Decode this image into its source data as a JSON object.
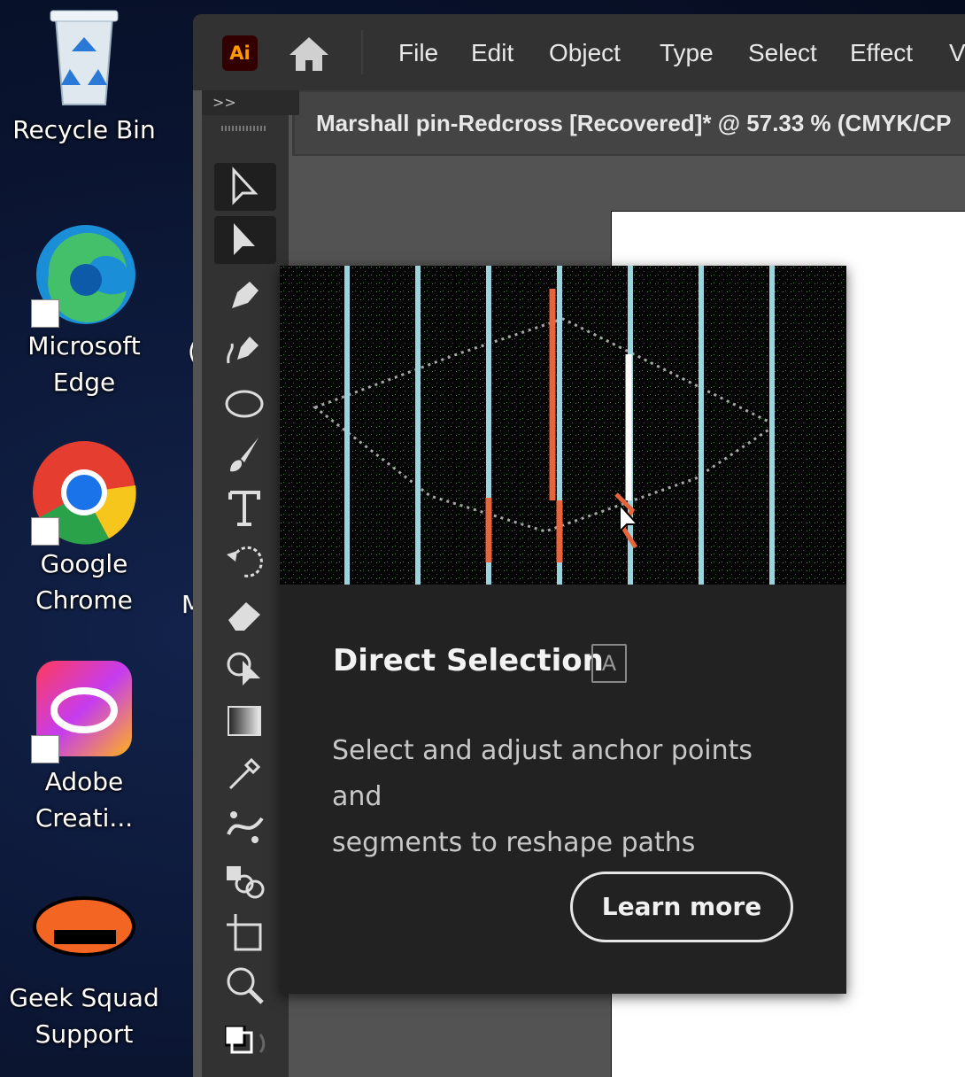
{
  "desktop": {
    "icons": [
      {
        "id": "recycle-bin",
        "label": "Recycle Bin"
      },
      {
        "id": "microsoft-edge",
        "label": "Microsoft Edge"
      },
      {
        "id": "google-chrome",
        "label": "Google Chrome"
      },
      {
        "id": "adobe-creative-cloud",
        "label": "Adobe Creati..."
      },
      {
        "id": "geek-squad-support",
        "label": "Geek Squad Support"
      }
    ],
    "partial_letters": [
      "(",
      "M"
    ]
  },
  "illustrator": {
    "logo": "Ai",
    "menu": [
      "File",
      "Edit",
      "Object",
      "Type",
      "Select",
      "Effect",
      "V"
    ],
    "document_tab": "Marshall pin-Redcross [Recovered]* @ 57.33 % (CMYK/CP",
    "panel_collapse": ">>",
    "tools": [
      "selection-tool-icon",
      "direct-selection-tool-icon",
      "pen-tool-icon",
      "curvature-tool-icon",
      "ellipse-tool-icon",
      "paintbrush-tool-icon",
      "type-tool-icon",
      "rotate-tool-icon",
      "eraser-tool-icon",
      "shape-builder-tool-icon",
      "gradient-tool-icon",
      "eyedropper-tool-icon",
      "puppet-warp-tool-icon",
      "blend-tool-icon",
      "artboard-tool-icon",
      "zoom-tool-icon"
    ]
  },
  "tooltip": {
    "title": "Direct Selection",
    "shortcut": "A",
    "description_line1": "Select and adjust anchor points and",
    "description_line2": "segments to reshape paths",
    "button": "Learn more"
  },
  "colors": {
    "accent_orange": "#e8643c",
    "guide_blue": "#9cd3dc",
    "ai_brand_bg": "#330000",
    "ai_brand_fg": "#ff9a00"
  }
}
